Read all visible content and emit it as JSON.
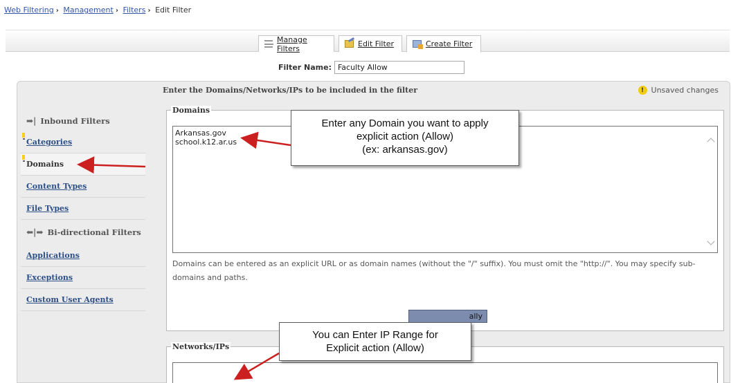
{
  "breadcrumb": {
    "items": [
      "Web Filtering",
      "Management",
      "Filters"
    ],
    "current": "Edit Filter"
  },
  "tabs": [
    {
      "label": "Manage Filters",
      "icon": "list-icon"
    },
    {
      "label": "Edit Filter",
      "icon": "edit-icon"
    },
    {
      "label": "Create Filter",
      "icon": "create-icon"
    }
  ],
  "filter_name": {
    "label": "Filter Name:",
    "value": "Faculty Allow"
  },
  "panel": {
    "heading": "Enter the Domains/Networks/IPs to be included in the filter",
    "unsaved": "Unsaved changes"
  },
  "sidebar": {
    "inbound_header": "Inbound Filters",
    "inbound_items": [
      "Categories",
      "Domains",
      "Content Types",
      "File Types"
    ],
    "bidirectional_header": "Bi-directional Filters",
    "bidirectional_items": [
      "Applications",
      "Exceptions",
      "Custom User Agents"
    ]
  },
  "domains": {
    "legend": "Domains",
    "entries": [
      "Arkansas.gov",
      "school.k12.ar.us"
    ],
    "help": "Domains can be entered as an explicit URL or as domain names (without the \"/\" suffix). You must omit the \"http://\". You may specify sub-domains and paths.",
    "button_fragment": "ally"
  },
  "networks": {
    "legend": "Networks/IPs"
  },
  "callouts": {
    "domain": [
      "Enter any Domain you want to apply",
      "explicit action (Allow)",
      "(ex: arkansas.gov)"
    ],
    "ip": [
      "You can Enter IP Range for",
      "Explicit action (Allow)"
    ]
  },
  "colors": {
    "arrow": "#cc1f1f",
    "link": "#2b4f86",
    "warning": "#f1cc17"
  }
}
